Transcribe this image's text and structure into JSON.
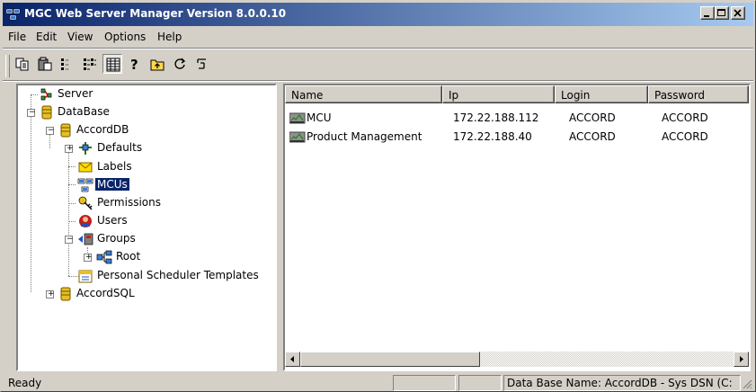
{
  "window": {
    "title": "MGC Web Server Manager Version 8.0.0.10"
  },
  "menu": [
    "File",
    "Edit",
    "View",
    "Options",
    "Help"
  ],
  "toolbar": {
    "buttons": [
      "copy-icon",
      "paste-icon",
      "small-icons-view-icon",
      "list-view-icon",
      "details-view-icon",
      "help-icon",
      "up-folder-icon",
      "refresh-icon",
      "reconnect-icon"
    ],
    "pressed": "details-view-icon"
  },
  "tree": {
    "server": "Server",
    "database": "DataBase",
    "accorddb": "AccordDB",
    "defaults": "Defaults",
    "labels": "Labels",
    "mcus": "MCUs",
    "permissions": "Permissions",
    "users": "Users",
    "groups": "Groups",
    "root": "Root",
    "templates": "Personal Scheduler Templates",
    "accordsql": "AccordSQL",
    "selected": "MCUs"
  },
  "list": {
    "columns": [
      "Name",
      "Ip",
      "Login",
      "Password"
    ],
    "rows": [
      {
        "name": "MCU",
        "ip": "172.22.188.112",
        "login": "ACCORD",
        "password": "ACCORD"
      },
      {
        "name": "Product Management",
        "ip": "172.22.188.40",
        "login": "ACCORD",
        "password": "ACCORD"
      }
    ]
  },
  "status": {
    "text": "Ready",
    "db_info": "Data Base Name: AccordDB - Sys DSN (C:"
  },
  "colors": {
    "titlebar_start": "#0a246a",
    "titlebar_end": "#a6caf0",
    "selection": "#0a246a",
    "face": "#d4d0c8"
  }
}
